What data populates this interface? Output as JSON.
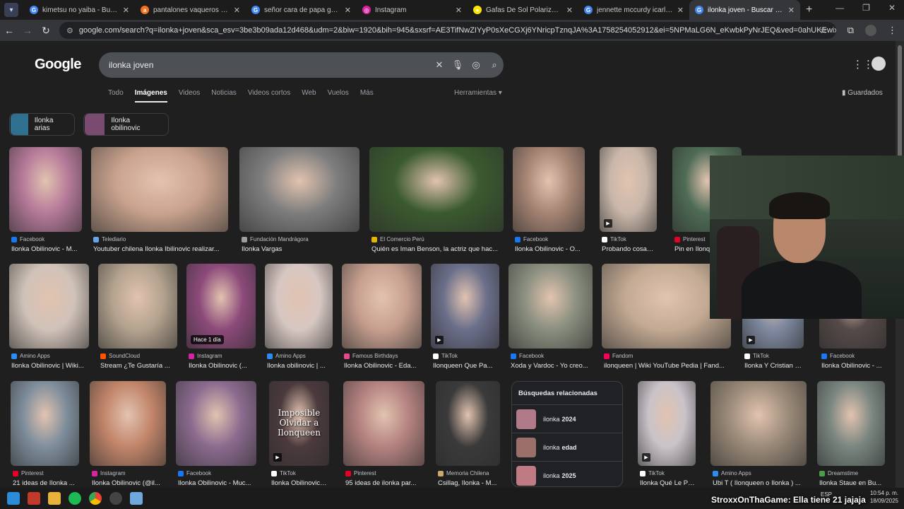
{
  "browser": {
    "tabs": [
      {
        "title": "kimetsu no yaiba - Buscar con Goo",
        "fav_color": "#4285f4",
        "fav_text": "G"
      },
      {
        "title": "pantalones vaqueros hombre p...",
        "fav_color": "#f36f21",
        "fav_text": "a"
      },
      {
        "title": "señor cara de papa gafas - Bus...",
        "fav_color": "#4285f4",
        "fav_text": "G"
      },
      {
        "title": "Instagram",
        "fav_color": "#d6249f",
        "fav_text": "◎"
      },
      {
        "title": "Gafas De Sol Polarizadas De Al...",
        "fav_color": "#ffe600",
        "fav_text": "●"
      },
      {
        "title": "jennette mccurdy icarly - Busca...",
        "fav_color": "#4285f4",
        "fav_text": "G"
      },
      {
        "title": "ilonka joven - Buscar con Goog...",
        "fav_color": "#4285f4",
        "fav_text": "G"
      }
    ],
    "url": "google.com/search?q=ilonka+joven&sca_esv=3be3b09ada12d468&udm=2&biw=1920&bih=945&sxsrf=AE3TifNwZIYyP0sXeCGXj6YNricpTznqJA%3A1758254052912&ei=5NPMaLG6N_eKwbkPyNrJEQ&ved=0ahUKEwixvP7h9uOPAxV3RTABHUhtMgIQ4dUD..."
  },
  "google": {
    "logo": "Google",
    "query": "ilonka joven",
    "filters": [
      "Todo",
      "Imágenes",
      "Videos",
      "Noticias",
      "Videos cortos",
      "Web",
      "Vuelos",
      "Más"
    ],
    "active_filter": 1,
    "tools": "Herramientas",
    "saved": "Guardados",
    "chips": [
      {
        "label": "Ilonka arias",
        "color": "#2f6f8f"
      },
      {
        "label": "Ilonka obilinovic",
        "color": "#7a4b70"
      }
    ]
  },
  "results": [
    {
      "src": "Facebook",
      "caption": "Ilonka Obilinovic - M...",
      "color": "#b67a9a",
      "icon": "#1877f2"
    },
    {
      "src": "Telediario",
      "caption": "Youtuber chilena Ilonka Ibilinovic realizar...",
      "color": "#caa38e",
      "icon": "#6aa4e8"
    },
    {
      "src": "Fundación Mandrágora",
      "caption": "Ilonka Vargas",
      "color": "#7d7d7d",
      "icon": "#9e9e9e"
    },
    {
      "src": "El Comercio Perú",
      "caption": "Quién es Iman Benson, la actriz que hac...",
      "color": "#3b5a2f",
      "icon": "#e2b600"
    },
    {
      "src": "Facebook",
      "caption": "Ilonka Obilinovic - O...",
      "color": "#a68574",
      "icon": "#1877f2"
    },
    {
      "src": "TikTok",
      "caption": "Probando cosas di...",
      "color": "#c9b7aa",
      "icon": "#ffffff"
    },
    {
      "src": "Pinterest",
      "caption": "Pin en Ilonq...",
      "color": "#4e6b55",
      "icon": "#e60023"
    },
    {
      "src": "Amino Apps",
      "caption": "Ilonka Obilinovic | Wiki...",
      "color": "#d0c2b8",
      "icon": "#2d8cf0"
    },
    {
      "src": "SoundCloud",
      "caption": "Stream ¿Te Gustaría ...",
      "color": "#b4a38f",
      "icon": "#ff5500"
    },
    {
      "src": "Instagram",
      "caption": "Ilonka Obilinovic (...",
      "color": "#8c4a7a",
      "icon": "#d6249f",
      "badge": "Hace 1 día"
    },
    {
      "src": "Amino Apps",
      "caption": "Ilonka obilinovic | ...",
      "color": "#d7c7c2",
      "icon": "#2d8cf0"
    },
    {
      "src": "Famous Birthdays",
      "caption": "Ilonka Obilinovic - Eda...",
      "color": "#c79f8f",
      "icon": "#e8478b"
    },
    {
      "src": "TikTok",
      "caption": "Ilonqueen Que Pa...",
      "color": "#6b6f8a",
      "icon": "#ffffff"
    },
    {
      "src": "Facebook",
      "caption": "Xoda y Vardoc - Yo creo...",
      "color": "#8a8f7f",
      "icon": "#1877f2"
    },
    {
      "src": "Fandom",
      "caption": "ilonqueen | Wiki YouTube Pedia | Fand...",
      "color": "#c3aa93",
      "icon": "#fa005a"
    },
    {
      "src": "TikTok",
      "caption": "Ilonka Y Cristian | ...",
      "color": "#7f8aa0",
      "icon": "#ffffff"
    },
    {
      "src": "Facebook",
      "caption": "Ilonka Obilinovic - ...",
      "color": "#554a48",
      "icon": "#1877f2"
    },
    {
      "src": "Pinterest",
      "caption": "21 ideas de Ilonka ...",
      "color": "#7f8e9c",
      "icon": "#e60023"
    },
    {
      "src": "Instagram",
      "caption": "Ilonka Obilinovic (@il...",
      "color": "#c2856a",
      "icon": "#d6249f"
    },
    {
      "src": "Facebook",
      "caption": "Ilonka Obilinovic - Muc...",
      "color": "#8b6b8f",
      "icon": "#1877f2"
    },
    {
      "src": "TikTok",
      "caption": "Ilonka Obilinovic: ...",
      "color": "#4b3a3d",
      "icon": "#ffffff",
      "overlay_text": "Imposible Olvidar a Ilonqueen"
    },
    {
      "src": "Pinterest",
      "caption": "95 ideas de ilonka par...",
      "color": "#b48280",
      "icon": "#e60023"
    },
    {
      "src": "Memoria Chilena",
      "caption": "Csillag, Ilonka - M...",
      "color": "#3a3a3a",
      "icon": "#c8a96b"
    },
    {
      "src": "TikTok",
      "caption": "Ilonka Qué Le Pas...",
      "color": "#c9c3c9",
      "icon": "#ffffff"
    },
    {
      "src": "Amino Apps",
      "caption": "Ubi T ( Ilonqueen o Ilonka ) ...",
      "color": "#9a8a78",
      "icon": "#2d8cf0"
    },
    {
      "src": "Dreamstime",
      "caption": "Ilonka Staue en Bu...",
      "color": "#7a8680",
      "icon": "#4a9e4a"
    }
  ],
  "related": {
    "title": "Búsquedas relacionadas",
    "items": [
      {
        "prefix": "ilonka",
        "bold": "2024",
        "color": "#b07a88"
      },
      {
        "prefix": "ilonka",
        "bold": "edad",
        "color": "#9a6f6a"
      },
      {
        "prefix": "ilonka",
        "bold": "2025",
        "color": "#c07a84"
      }
    ]
  },
  "taskbar": {
    "lang": "ESP",
    "time": "10:54 p. m.",
    "date": "18/09/2025"
  },
  "stream": {
    "user": "StroxxOnThaGame",
    "message": ": Ella tiene 21 jajaja"
  }
}
